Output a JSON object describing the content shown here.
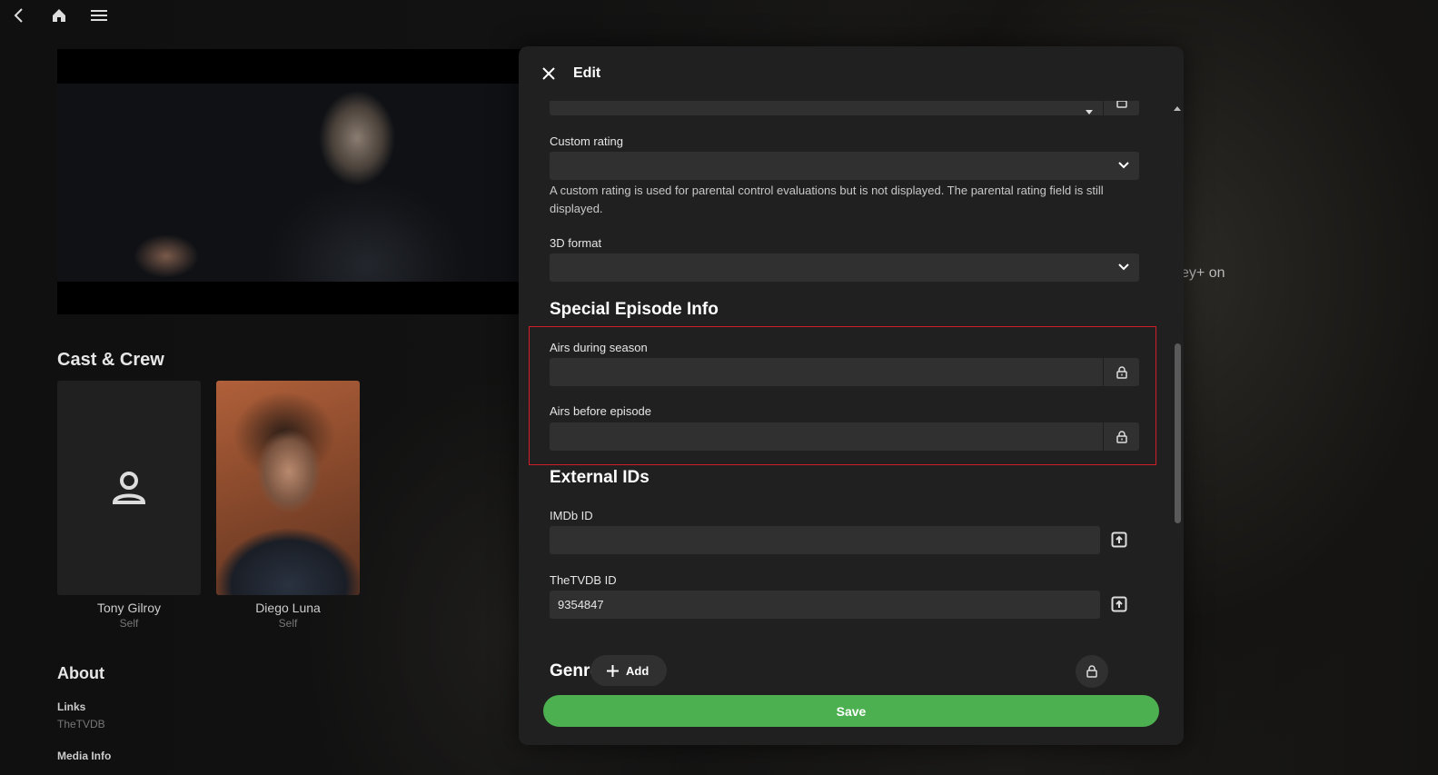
{
  "background": {
    "cast_title": "Cast & Crew",
    "cast": [
      {
        "name": "Tony Gilroy",
        "role": "Self"
      },
      {
        "name": "Diego Luna",
        "role": "Self"
      }
    ],
    "about_title": "About",
    "links_label": "Links",
    "links_value": "TheTVDB",
    "media_info_label": "Media Info",
    "overlay_text": "ey+ on"
  },
  "dialog": {
    "title": "Edit",
    "fields": {
      "custom_rating_label": "Custom rating",
      "custom_rating_help": "A custom rating is used for parental control evaluations but is not displayed. The parental rating field is still displayed.",
      "format3d_label": "3D format"
    },
    "special_episode": {
      "heading": "Special Episode Info",
      "airs_during_season_label": "Airs during season",
      "airs_before_episode_label": "Airs before episode"
    },
    "external_ids": {
      "heading": "External IDs",
      "imdb_label": "IMDb ID",
      "imdb_value": "",
      "tvdb_label": "TheTVDB ID",
      "tvdb_value": "9354847"
    },
    "genres": {
      "heading": "Genres",
      "add_label": "Add"
    },
    "save_label": "Save"
  },
  "colors": {
    "dialog_bg": "#202020",
    "input_bg": "#303030",
    "save_green": "#4caf50",
    "highlight_red": "#d11e2b"
  }
}
